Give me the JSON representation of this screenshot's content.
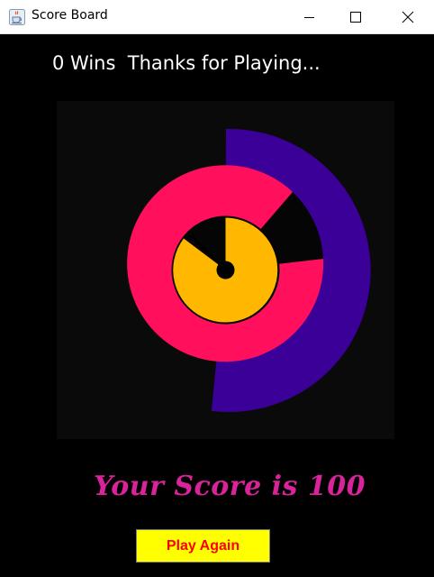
{
  "window": {
    "title": "Score Board",
    "icon": "java-coffee-icon",
    "controls": [
      "minimize-icon",
      "maximize-icon",
      "close-icon"
    ]
  },
  "status": {
    "text": "0 Wins  Thanks for Playing..."
  },
  "board": {
    "background": "#0a0a0a",
    "rings": [
      {
        "name": "outer-ring",
        "color": "#3a0098"
      },
      {
        "name": "middle-ring",
        "color": "#ff0f5c"
      },
      {
        "name": "inner-ring",
        "color": "#ffb700"
      }
    ]
  },
  "score": {
    "text": "Your Score is 100",
    "color": "#d9239a"
  },
  "actions": {
    "play_again_label": "Play Again",
    "play_again_bg": "#ffff00",
    "play_again_color": "#ff0000"
  }
}
